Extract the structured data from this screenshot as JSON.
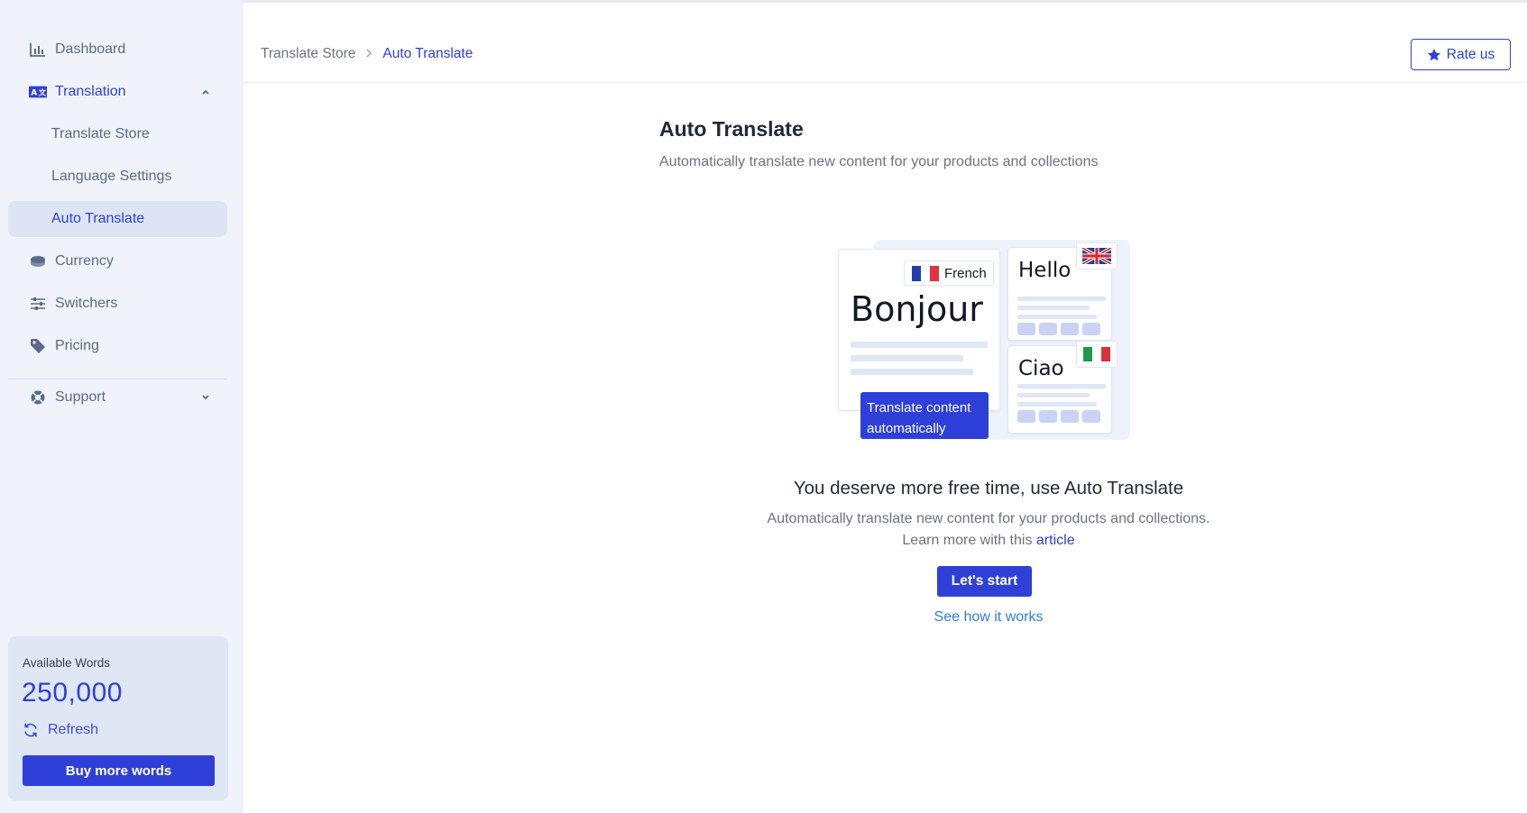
{
  "sidebar": {
    "nav": {
      "dashboard": "Dashboard",
      "translation": "Translation",
      "translate_store": "Translate Store",
      "language_settings": "Language Settings",
      "auto_translate": "Auto Translate",
      "currency": "Currency",
      "switchers": "Switchers",
      "pricing": "Pricing",
      "support": "Support"
    },
    "words": {
      "label": "Available Words",
      "count": "250,000",
      "refresh": "Refresh",
      "buy": "Buy more words"
    }
  },
  "header": {
    "breadcrumb": [
      "Translate Store",
      "Auto Translate"
    ],
    "rate_label": "Rate us"
  },
  "main": {
    "title": "Auto Translate",
    "subtitle": "Automatically translate new content for your products and collections",
    "illustration": {
      "lang_tag": "French",
      "word_main": "Bonjour",
      "word_en": "Hello",
      "word_it": "Ciao",
      "tooltip": "Translate content automatically"
    },
    "cta": {
      "heading": "You deserve more free time, use Auto Translate",
      "desc_line1": "Automatically translate new content for your products and collections.",
      "desc_line2": "Learn more with this",
      "link": "article",
      "start": "Let's start",
      "how": "See how it works"
    }
  },
  "colors": {
    "accent": "#2f40d9",
    "sidebar_bg": "#f0f3f9",
    "link": "#2f7de1"
  }
}
